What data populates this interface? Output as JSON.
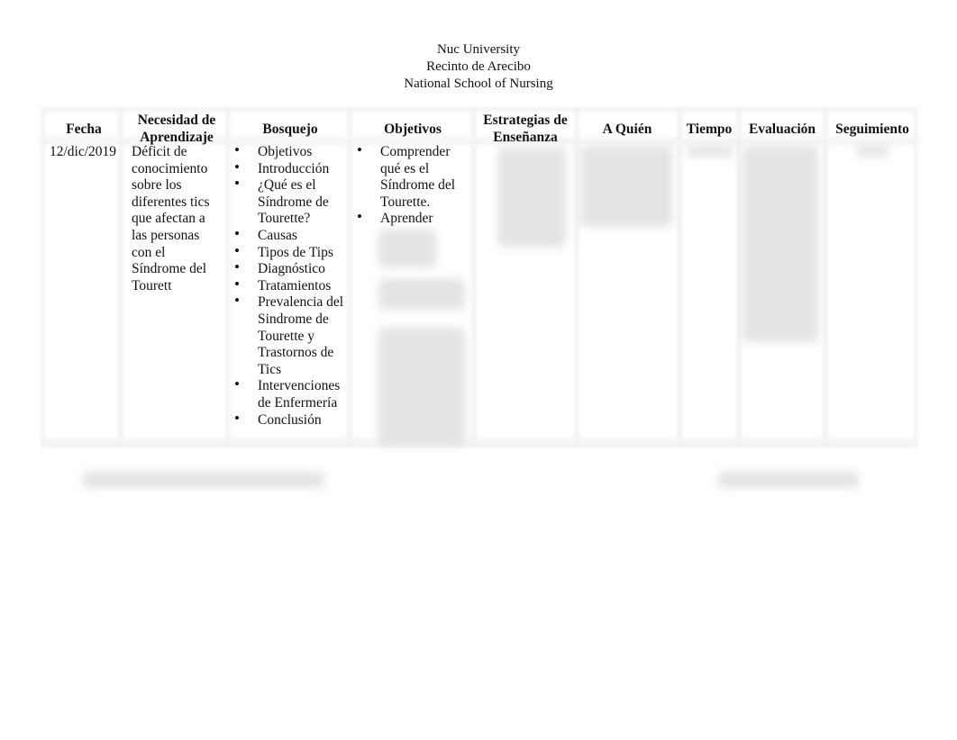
{
  "header": {
    "line1": "Nuc University",
    "line2": "Recinto de Arecibo",
    "line3": "National School of Nursing"
  },
  "table": {
    "columns": [
      "Fecha",
      "Necesidad de Aprendizaje",
      "Bosquejo",
      "Objetivos",
      "Estrategias de Enseñanza",
      "A Quién",
      "Tiempo",
      "Evaluación",
      "Seguimiento"
    ],
    "row": {
      "fecha": "12/dic/2019",
      "necesidad": "Déficit de conocimiento sobre los diferentes tics que afectan a las personas con el Síndrome del Tourett",
      "bosquejo": [
        "Objetivos",
        "Introducción",
        "¿Qué es el Síndrome de Tourette?",
        "Causas",
        "Tipos de Tips",
        "Diagnóstico",
        "Tratamientos",
        "Prevalencia del Sindrome de Tourette y Trastornos de Tics",
        "Intervenciones de Enfermería",
        "Conclusión"
      ],
      "objetivos": [
        "Comprender qué es el Síndrome del Tourette.",
        "Aprender"
      ]
    }
  }
}
